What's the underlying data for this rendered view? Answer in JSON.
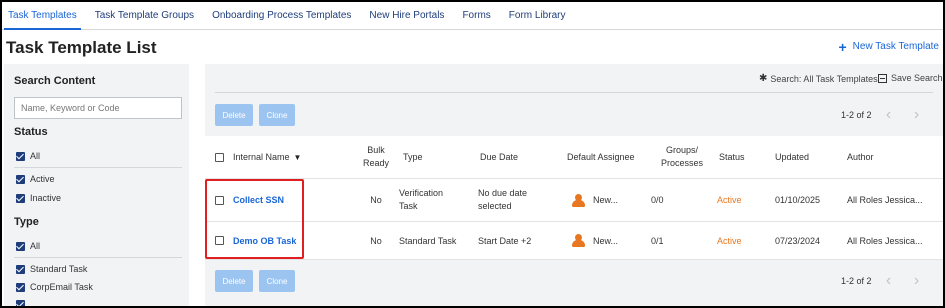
{
  "tabs": [
    {
      "label": "Task Templates",
      "active": true
    },
    {
      "label": "Task Template Groups",
      "active": false
    },
    {
      "label": "Onboarding Process Templates",
      "active": false
    },
    {
      "label": "New Hire Portals",
      "active": false
    },
    {
      "label": "Forms",
      "active": false
    },
    {
      "label": "Form Library",
      "active": false
    }
  ],
  "page": {
    "title": "Task Template List",
    "new_button": "New Task Template"
  },
  "sidebar": {
    "search_heading": "Search Content",
    "search_placeholder": "Name, Keyword or Code",
    "status_heading": "Status",
    "status_options": [
      {
        "label": "All",
        "checked": true
      },
      {
        "label": "Active",
        "checked": true
      },
      {
        "label": "Inactive",
        "checked": true
      }
    ],
    "type_heading": "Type",
    "type_options": [
      {
        "label": "All",
        "checked": true
      },
      {
        "label": "Standard Task",
        "checked": true
      },
      {
        "label": "CorpEmail Task",
        "checked": true
      }
    ]
  },
  "toolbar": {
    "search_label": "Search: All Task Templates",
    "save_search": "Save Search",
    "delete": "Delete",
    "clone": "Clone",
    "pagination": "1-2 of 2"
  },
  "table": {
    "headers": {
      "name": "Internal Name",
      "bulk": "Bulk Ready",
      "type": "Type",
      "due": "Due Date",
      "assignee": "Default Assignee",
      "groups": "Groups/ Processes",
      "status": "Status",
      "updated": "Updated",
      "author": "Author"
    },
    "rows": [
      {
        "name": "Collect SSN",
        "bulk": "No",
        "type": "Verification Task",
        "due": "No due date selected",
        "assignee": "New...",
        "groups": "0/0",
        "status": "Active",
        "updated": "01/10/2025",
        "author": "All Roles Jessica..."
      },
      {
        "name": "Demo OB Task",
        "bulk": "No",
        "type": "Standard Task",
        "due": "Start Date +2",
        "assignee": "New...",
        "groups": "0/1",
        "status": "Active",
        "updated": "07/23/2024",
        "author": "All Roles Jessica..."
      }
    ]
  },
  "colors": {
    "accent": "#1a66d6",
    "active_status": "#e87722",
    "highlight": "#e02020"
  }
}
